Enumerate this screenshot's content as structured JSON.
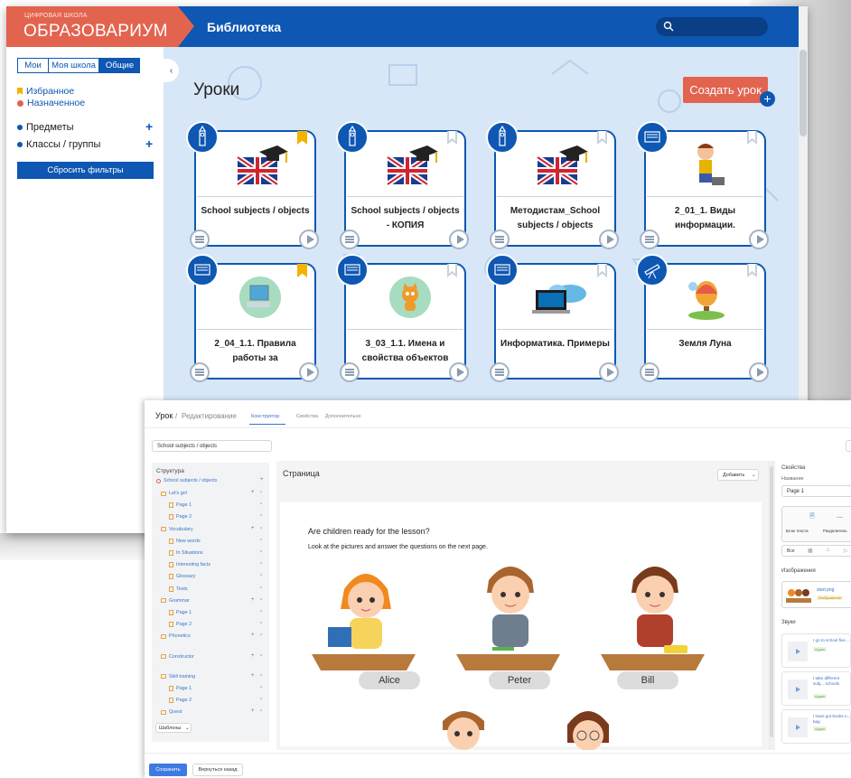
{
  "lib": {
    "logo_small": "ЦИФРОВАЯ ШКОЛА",
    "logo_big": "ОБРАЗОВАРИУМ",
    "header_title": "Библиотека",
    "tabs": [
      "Мои",
      "Моя школа",
      "Общие"
    ],
    "side_favorites": "Избранное",
    "side_assigned": "Назначенное",
    "side_subjects": "Предметы",
    "side_classes": "Классы / группы",
    "reset_filters": "Сбросить фильтры",
    "page_title": "Уроки",
    "create_lesson": "Создать урок",
    "cards": [
      {
        "title": "School subjects / objects",
        "favorite": true
      },
      {
        "title": "School subjects / objects - КОПИЯ",
        "favorite": false
      },
      {
        "title": "Методистам_School subjects / objects",
        "favorite": false
      },
      {
        "title": "2_01_1. Виды информации.",
        "favorite": false
      },
      {
        "title": "2_04_1.1. Правила работы за",
        "favorite": true
      },
      {
        "title": "3_03_1.1. Имена и свойства объектов",
        "favorite": false
      },
      {
        "title": "Информатика. Примеры",
        "favorite": false
      },
      {
        "title": "Земля Луна",
        "favorite": false
      }
    ],
    "colors": {
      "brand_blue": "#0e57b3",
      "brand_coral": "#e2644f",
      "favorite": "#f4b300"
    }
  },
  "editor": {
    "crumb_main": "Урок",
    "crumb_sub": "Редактирование",
    "tabs": [
      "Конструктор",
      "Свойства",
      "Дополнительно"
    ],
    "lesson_name": "School subjects / objects",
    "structure_label": "Структура",
    "root": "School subjects / objects",
    "tree": [
      {
        "label": "Let's go!",
        "level": 1
      },
      {
        "label": "Page 1",
        "level": 2
      },
      {
        "label": "Page 2",
        "level": 2
      },
      {
        "label": "Vocabulary",
        "level": 1
      },
      {
        "label": "New words",
        "level": 2
      },
      {
        "label": "In Situations",
        "level": 2
      },
      {
        "label": "Interesting facts",
        "level": 2
      },
      {
        "label": "Glossary",
        "level": 2
      },
      {
        "label": "Tests",
        "level": 2
      },
      {
        "label": "Grammar",
        "level": 1
      },
      {
        "label": "Page 1",
        "level": 2
      },
      {
        "label": "Page 2",
        "level": 2
      },
      {
        "label": "Phonetics",
        "level": 1
      },
      {
        "label": "Constructor",
        "level": 1
      },
      {
        "label": "Skill training",
        "level": 1
      },
      {
        "label": "Page 1",
        "level": 2
      },
      {
        "label": "Page 2",
        "level": 2
      },
      {
        "label": "Quest",
        "level": 1
      }
    ],
    "templates_btn": "Шаблоны",
    "page_label": "Страница",
    "add_btn": "Добавить",
    "question": "Are children ready for the lesson?",
    "instruction": "Look at the pictures and answer the questions on the next page.",
    "names": [
      "Alice",
      "Peter",
      "Bill"
    ],
    "props_label": "Свойства",
    "name_label": "Название",
    "name_value": "Page 1",
    "tool_text": "Блок текста",
    "tool_divider": "Разделитель",
    "filter_all": "Все",
    "images_label": "Изображения",
    "image_item": "start.png",
    "image_tag": "Изображение",
    "sounds_label": "Звуки",
    "sounds": [
      "I go to school five ...",
      "I take different subj... schools",
      "I have got books n... bag"
    ],
    "sound_tag": "Аудио",
    "save_btn": "Сохранить",
    "back_btn": "Вернуться назад"
  }
}
